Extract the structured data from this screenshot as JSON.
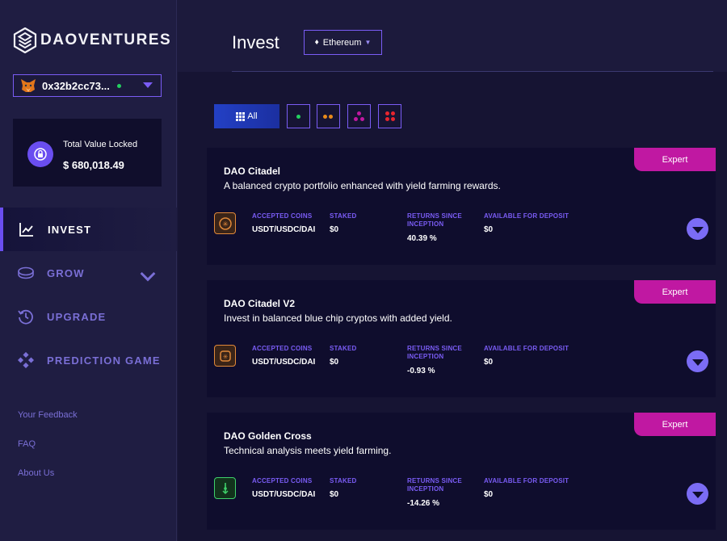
{
  "app": {
    "logo_text": "DAOVENTURES"
  },
  "wallet": {
    "address": "0x32b2cc73...",
    "connected_color": "#23d160"
  },
  "tvl": {
    "label": "Total Value Locked",
    "value": "$ 680,018.49"
  },
  "nav": [
    {
      "label": "INVEST",
      "icon": "chart-line-icon",
      "active": true
    },
    {
      "label": "GROW",
      "icon": "coin-stack-icon",
      "active": false
    },
    {
      "label": "UPGRADE",
      "icon": "history-icon",
      "active": false
    },
    {
      "label": "PREDICTION GAME",
      "icon": "gamepad-icon",
      "active": false
    }
  ],
  "footer_links": [
    "Your Feedback",
    "FAQ",
    "About Us"
  ],
  "header": {
    "title": "Invest",
    "network": "Ethereum"
  },
  "filters": {
    "all_label": "All"
  },
  "columns": {
    "accepted_coins": "ACCEPTED COINS",
    "staked": "STAKED",
    "returns_line1": "RETURNS SINCE",
    "returns_line2": "INCEPTION",
    "available": "AVAILABLE FOR DEPOSIT"
  },
  "strategies": [
    {
      "badge": "Expert",
      "title": "DAO Citadel",
      "description": "A balanced crypto portfolio enhanced with yield farming rewards.",
      "accepted_coins": "USDT/USDC/DAI",
      "staked": "$0",
      "returns": "40.39 %",
      "available": "$0",
      "icon": "citadel-icon"
    },
    {
      "badge": "Expert",
      "title": "DAO Citadel V2",
      "description": "Invest in balanced blue chip cryptos with added yield.",
      "accepted_coins": "USDT/USDC/DAI",
      "staked": "$0",
      "returns": "-0.93 %",
      "available": "$0",
      "icon": "citadel-v2-icon"
    },
    {
      "badge": "Expert",
      "title": "DAO Golden Cross",
      "description": "Technical analysis meets yield farming.",
      "accepted_coins": "USDT/USDC/DAI",
      "staked": "$0",
      "returns": "-14.26 %",
      "available": "$0",
      "icon": "golden-cross-icon"
    }
  ],
  "colors": {
    "accent": "#7a5cf5",
    "badge": "#c018a2",
    "sidebar": "#1f1d42",
    "card": "#0f0d2d"
  }
}
